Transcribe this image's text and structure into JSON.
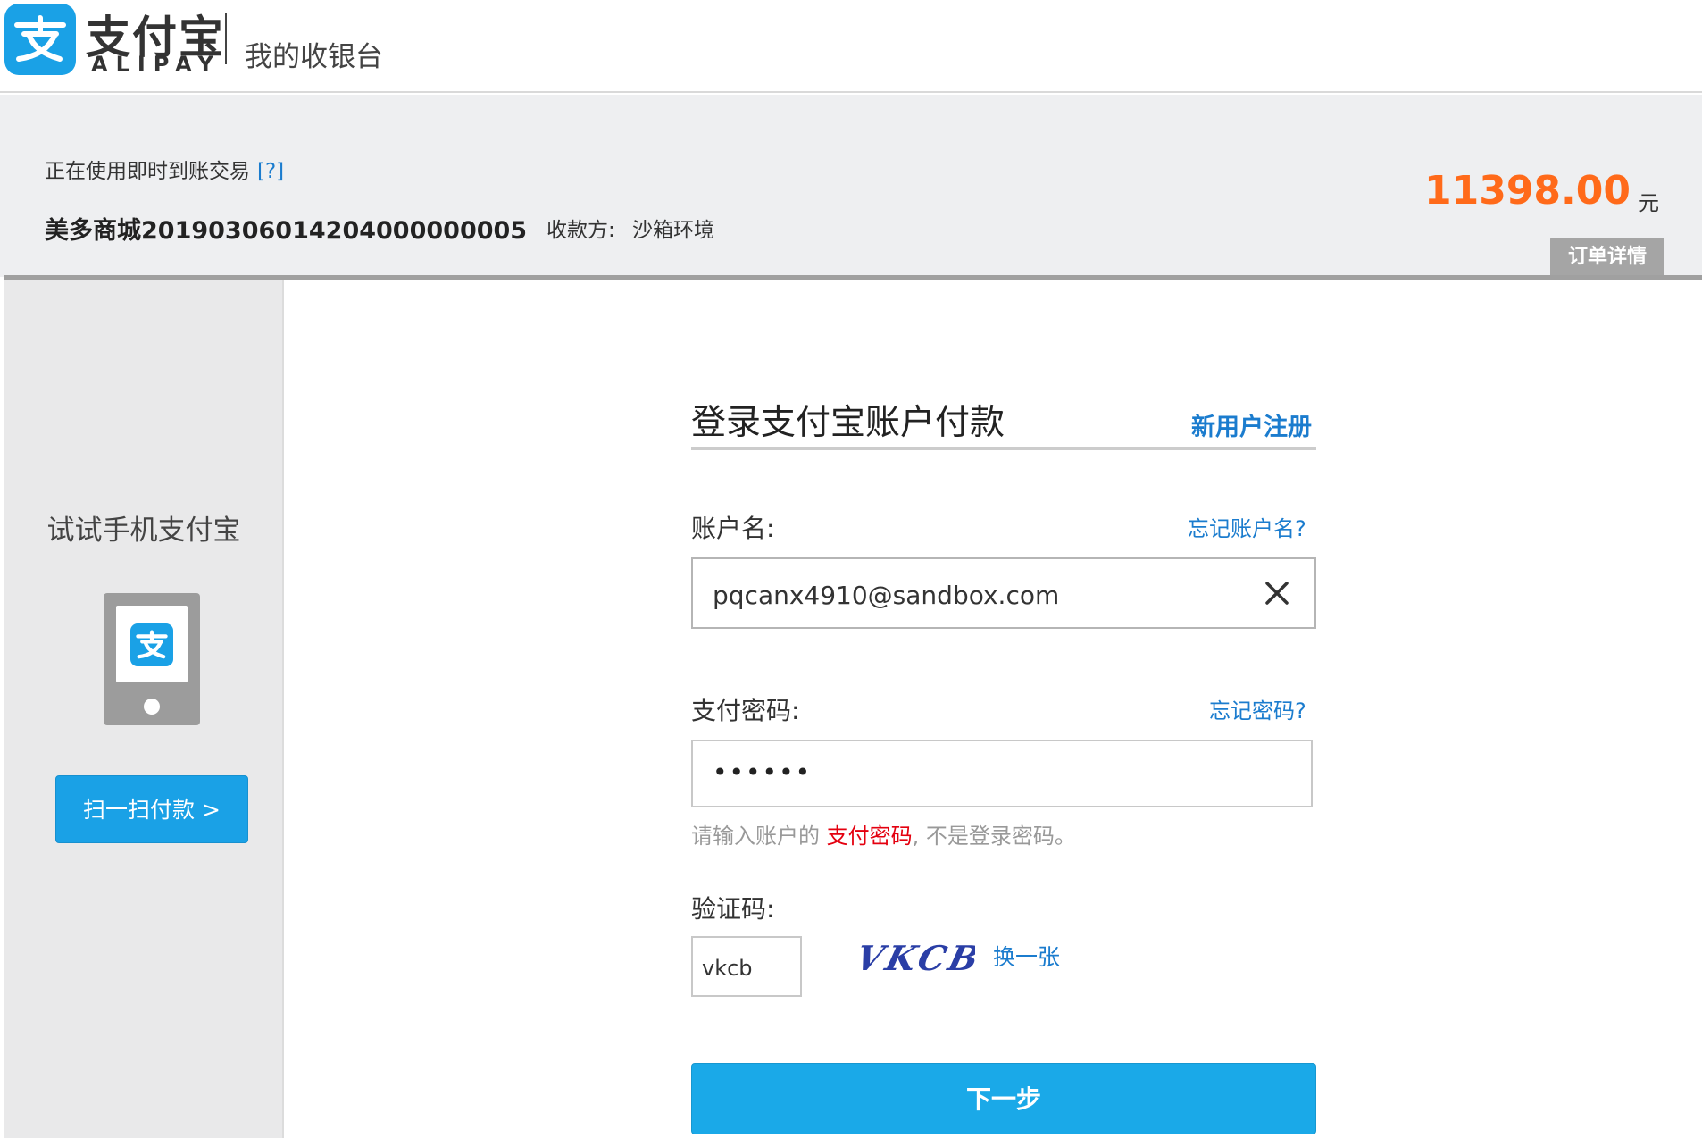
{
  "header": {
    "brand_cn": "支付宝",
    "brand_en": "ALIPAY",
    "title": "我的收银台",
    "logo_icon": "alipay-logo-icon"
  },
  "order": {
    "trade_type": "正在使用即时到账交易",
    "trade_help": "[?]",
    "title": "美多商城20190306014204000000005",
    "payee_label": "收款方:",
    "payee_value": "沙箱环境",
    "amount": "11398.00",
    "amount_unit": "元",
    "detail_button": "订单详情",
    "amount_color": "#ff6a1a"
  },
  "left_panel": {
    "title": "试试手机支付宝",
    "scan_button": "扫一扫付款 >",
    "phone_icon": "mobile-phone-icon"
  },
  "form": {
    "title": "登录支付宝账户付款",
    "register_link": "新用户注册",
    "account_label": "账户名:",
    "forgot_account": "忘记账户名?",
    "account_value": "pqcanx4910@sandbox.com",
    "clear_icon": "close-icon",
    "password_label": "支付密码:",
    "forgot_password": "忘记密码?",
    "password_value": "••••••",
    "password_hint_prefix": "请输入账户的 ",
    "password_hint_highlight": "支付密码",
    "password_hint_suffix": ", 不是登录密码。",
    "captcha_label": "验证码:",
    "captcha_value": "vkcb",
    "captcha_image_text": "VKCB",
    "captcha_refresh": "换一张",
    "next_button": "下一步"
  },
  "colors": {
    "accent_blue": "#1aa1e6",
    "link_blue": "#1b7cce",
    "hint_red": "#e4000f"
  }
}
